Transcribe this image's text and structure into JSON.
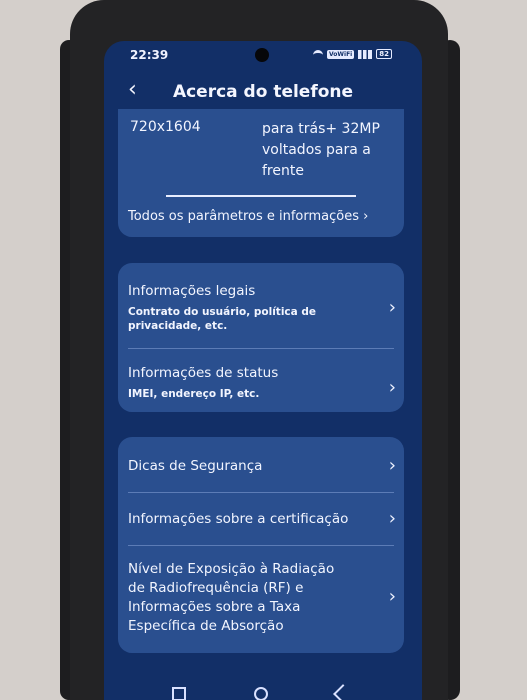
{
  "status": {
    "time": "22:39"
  },
  "header": {
    "back_icon": "chevron-left-icon",
    "title": "Acerca do telefone"
  },
  "specs": {
    "resolution": "720x1604",
    "camera_lines": [
      "para trás+ 32MP",
      "voltados para a",
      "frente"
    ],
    "all_params_label": "Todos os parâmetros e informações ›"
  },
  "legal": {
    "title": "Informações legais",
    "subtitle": "Contrato do usuário, política de privacidade, etc."
  },
  "status_info": {
    "title": "Informações de status",
    "subtitle": "IMEI, endereço IP, etc."
  },
  "safety": {
    "title": "Dicas de Segurança"
  },
  "certification": {
    "title": "Informações sobre a certificação"
  },
  "sar": {
    "lines": [
      "Nível de Exposição à Radiação",
      "de Radiofrequência (RF) e",
      "Informações sobre a Taxa",
      "Específica de Absorção"
    ]
  },
  "colors": {
    "background": "#122f67",
    "card": "#2a4f8f",
    "text": "#f2f5ff"
  }
}
